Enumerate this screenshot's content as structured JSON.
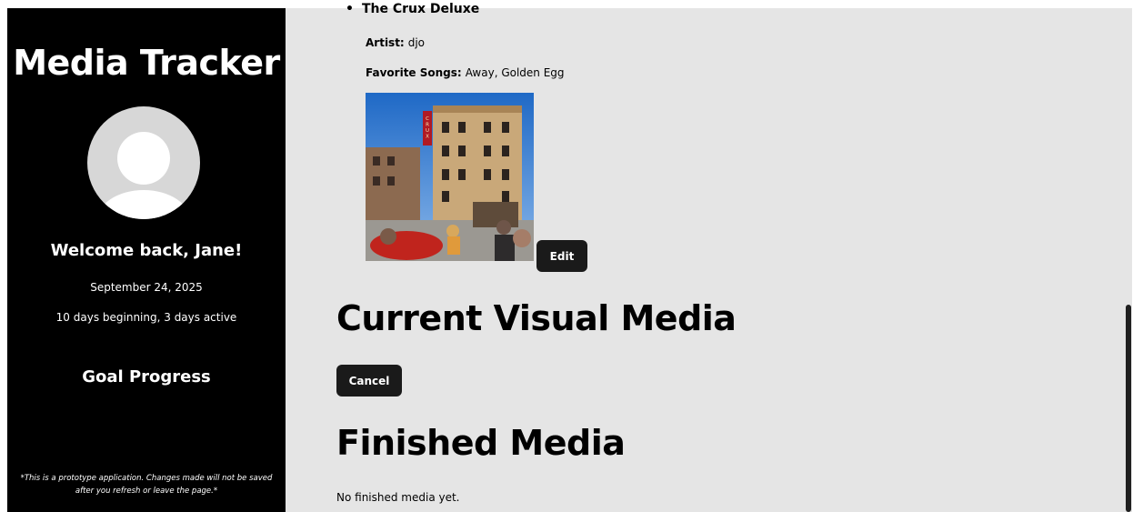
{
  "sidebar": {
    "title": "Media Tracker",
    "welcome": "Welcome back, Jane!",
    "date": "September 24, 2025",
    "streak": "10 days beginning, 3 days active",
    "goal_progress": "Goal Progress",
    "disclaimer": "*This is a prototype application. Changes made will not be saved after you refresh or leave the page.*"
  },
  "main": {
    "album": {
      "title": "The Crux Deluxe",
      "artist_label": "Artist:",
      "artist": "djo",
      "songs_label": "Favorite Songs:",
      "songs": "Away, Golden Egg",
      "edit_label": "Edit",
      "cover_sign": "CRUX"
    },
    "current_title": "Current Visual Media",
    "cancel_label": "Cancel",
    "finished_title": "Finished Media",
    "finished_empty": "No finished media yet."
  },
  "colors": {
    "sidebar_bg": "#000000",
    "main_bg": "#e5e5e5",
    "button_bg": "#1a1a1a"
  }
}
